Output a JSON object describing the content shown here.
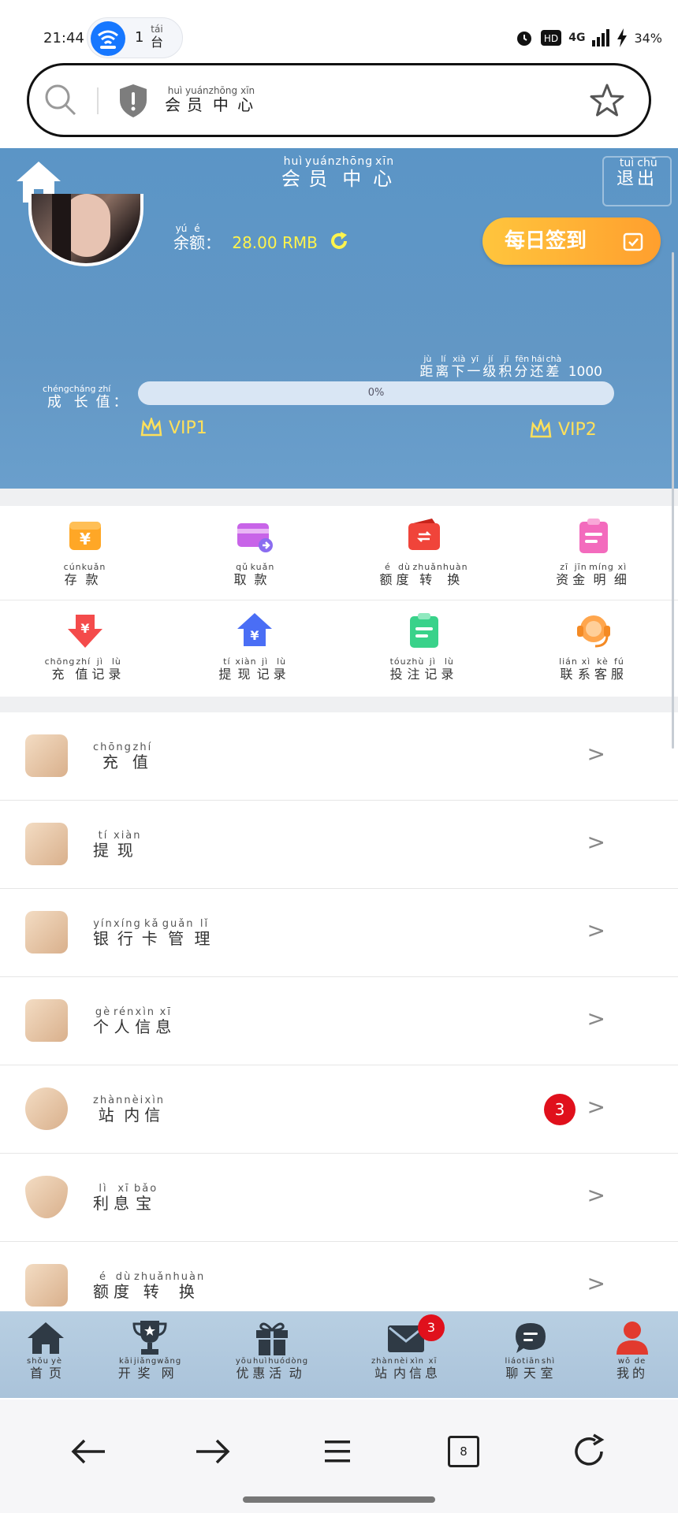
{
  "status_bar": {
    "time": "21:44",
    "device_count": "1",
    "device_unit": "台",
    "device_unit_pinyin": "tái",
    "network": "4G",
    "battery": "34%"
  },
  "address_bar": {
    "title": "会员中心",
    "title_pinyin": [
      "huì",
      "yuán",
      "zhōng",
      "xīn"
    ]
  },
  "header": {
    "title": "会员中心",
    "title_pinyin": [
      "huì",
      "yuán",
      "zhōng",
      "xīn"
    ],
    "logout_label": "退出",
    "logout_pinyin": [
      "tuì",
      "chū"
    ],
    "balance_label": "余额",
    "balance_pinyin": [
      "yú",
      "é"
    ],
    "balance_colon": "：",
    "balance_value": "28.00 RMB",
    "checkin_label": "每日签到",
    "next_level_text": "距离下一级积分还差",
    "next_level_pinyin": [
      "jù",
      "lí",
      "xià",
      "yī",
      "jí",
      "jī",
      "fēn",
      "hái",
      "chà"
    ],
    "next_level_points": "1000",
    "growth_label": "成长值",
    "growth_pinyin": [
      "chéng",
      "cháng",
      "zhí"
    ],
    "growth_colon": "：",
    "progress_text": "0%",
    "progress_fraction": 0,
    "vip_current": "VIP1",
    "vip_next": "VIP2"
  },
  "grid": [
    {
      "label": "存款",
      "pinyin": [
        "cún",
        "kuǎn"
      ],
      "icon": "deposit-icon",
      "color": "#ffa726"
    },
    {
      "label": "取款",
      "pinyin": [
        "qǔ",
        "kuǎn"
      ],
      "icon": "withdraw-icon",
      "color": "#c864e8"
    },
    {
      "label": "额度转换",
      "pinyin": [
        "é",
        "dù",
        "zhuǎn",
        "huàn"
      ],
      "icon": "transfer-icon",
      "color": "#f0443a"
    },
    {
      "label": "资金明细",
      "pinyin": [
        "zī",
        "jīn",
        "míng",
        "xì"
      ],
      "icon": "clipboard-icon",
      "color": "#f36bbd"
    },
    {
      "label": "充值记录",
      "pinyin": [
        "chōng",
        "zhí",
        "jì",
        "lù"
      ],
      "icon": "recharge-record-icon",
      "color": "#f44b4b"
    },
    {
      "label": "提现记录",
      "pinyin": [
        "tí",
        "xiàn",
        "jì",
        "lù"
      ],
      "icon": "withdraw-record-icon",
      "color": "#4a6ef5"
    },
    {
      "label": "投注记录",
      "pinyin": [
        "tóu",
        "zhù",
        "jì",
        "lù"
      ],
      "icon": "bet-record-icon",
      "color": "#39d28a"
    },
    {
      "label": "联系客服",
      "pinyin": [
        "lián",
        "xì",
        "kè",
        "fú"
      ],
      "icon": "headset-icon",
      "color": "#ffa64d"
    }
  ],
  "list": [
    {
      "label": "充值",
      "pinyin": [
        "chōng",
        "zhí"
      ],
      "icon": "recharge-icon",
      "badge": ""
    },
    {
      "label": "提现",
      "pinyin": [
        "tí",
        "xiàn"
      ],
      "icon": "withdraw-cash-icon",
      "badge": ""
    },
    {
      "label": "银行卡管理",
      "pinyin": [
        "yín",
        "xíng",
        "kǎ",
        "guǎn",
        "lǐ"
      ],
      "icon": "bank-card-icon",
      "badge": ""
    },
    {
      "label": "个人信息",
      "pinyin": [
        "gè",
        "rén",
        "xìn",
        "xī"
      ],
      "icon": "user-icon",
      "badge": ""
    },
    {
      "label": "站内信",
      "pinyin": [
        "zhàn",
        "nèi",
        "xìn"
      ],
      "icon": "mail-icon",
      "badge": "3"
    },
    {
      "label": "利息宝",
      "pinyin": [
        "lì",
        "xī",
        "bǎo"
      ],
      "icon": "diamond-icon",
      "badge": ""
    },
    {
      "label": "额度转换",
      "pinyin": [
        "é",
        "dù",
        "zhuǎn",
        "huàn"
      ],
      "icon": "exchange-icon",
      "badge": ""
    }
  ],
  "list_arrow": ">",
  "tabbar": [
    {
      "label": "首页",
      "pinyin": [
        "shǒu",
        "yè"
      ],
      "icon": "home-icon",
      "badge": ""
    },
    {
      "label": "开奖网",
      "pinyin": [
        "kāi",
        "jiǎng",
        "wǎng"
      ],
      "icon": "trophy-icon",
      "badge": ""
    },
    {
      "label": "优惠活动",
      "pinyin": [
        "yōu",
        "huì",
        "huó",
        "dòng"
      ],
      "icon": "gift-icon",
      "badge": ""
    },
    {
      "label": "站内信息",
      "pinyin": [
        "zhàn",
        "nèi",
        "xìn",
        "xī"
      ],
      "icon": "mail-icon",
      "badge": "3"
    },
    {
      "label": "聊天室",
      "pinyin": [
        "liáo",
        "tiān",
        "shì"
      ],
      "icon": "chat-icon",
      "badge": ""
    },
    {
      "label": "我的",
      "pinyin": [
        "wǒ",
        "de"
      ],
      "icon": "person-icon",
      "badge": ""
    }
  ],
  "browser_nav": {
    "tab_count": "8"
  },
  "colors": {
    "header": "#5b95c6",
    "accent_yellow": "#fff44d",
    "badge": "#e0101c",
    "active_tab": "#e23a2e"
  }
}
